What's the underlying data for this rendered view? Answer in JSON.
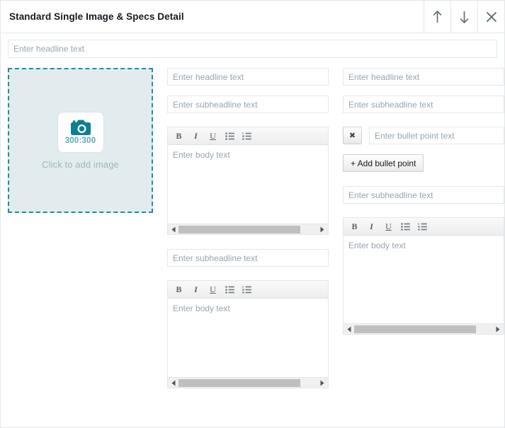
{
  "header": {
    "title": "Standard Single Image & Specs Detail",
    "move_up_label": "Move up",
    "move_down_label": "Move down",
    "close_label": "Close"
  },
  "top": {
    "headline_placeholder": "Enter headline text"
  },
  "image": {
    "ratio": "300:300",
    "cta": "Click to add image"
  },
  "editor": {
    "bold": "B",
    "italic": "I",
    "underline": "U",
    "bullet_list": "Bulleted list",
    "numbered_list": "Numbered list",
    "body_placeholder": "Enter body text"
  },
  "middle": {
    "headline_placeholder": "Enter headline text",
    "subheadline_placeholder": "Enter subheadline text",
    "subheadline2_placeholder": "Enter subheadline text"
  },
  "right": {
    "headline_placeholder": "Enter headline text",
    "subheadline_placeholder": "Enter subheadline text",
    "bullet_placeholder": "Enter bullet point text",
    "remove_bullet_label": "✖",
    "add_bullet_label": "+ Add bullet point",
    "subheadline2_placeholder": "Enter subheadline text"
  },
  "colors": {
    "accent": "#1a8fa3",
    "dropzone_fill": "#e2ecee",
    "placeholder_text": "#95a5b4",
    "border": "#e4e6e8"
  }
}
